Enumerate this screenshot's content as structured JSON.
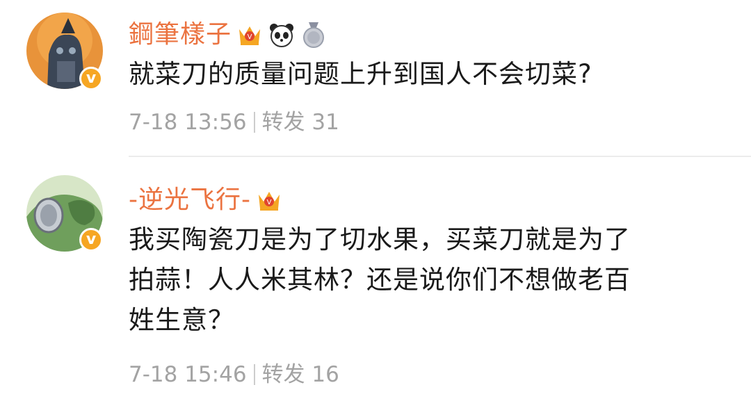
{
  "comments": [
    {
      "username": "鋼筆樣子",
      "badges": [
        "crown-badge",
        "panda-badge",
        "medal-badge"
      ],
      "verified_mark": "v",
      "text": "就菜刀的质量问题上升到国人不会切菜?",
      "date": "7-18 13:56",
      "repost_label": "转发",
      "repost_count": "31"
    },
    {
      "username": "-逆光飞行-",
      "badges": [
        "crown-badge"
      ],
      "verified_mark": "v",
      "text_lines": [
        "我买陶瓷刀是为了切水果，买菜刀就是为了",
        "拍蒜！人人米其林？还是说你们不想做老百",
        "姓生意？"
      ],
      "date": "7-18 15:46",
      "repost_label": "转发",
      "repost_count": "16"
    }
  ],
  "colors": {
    "username": "#eb7340",
    "body_text": "#1a1a1a",
    "meta_text": "#a3a3a3",
    "verified": "#f6a623",
    "crown": "#f5a623"
  }
}
